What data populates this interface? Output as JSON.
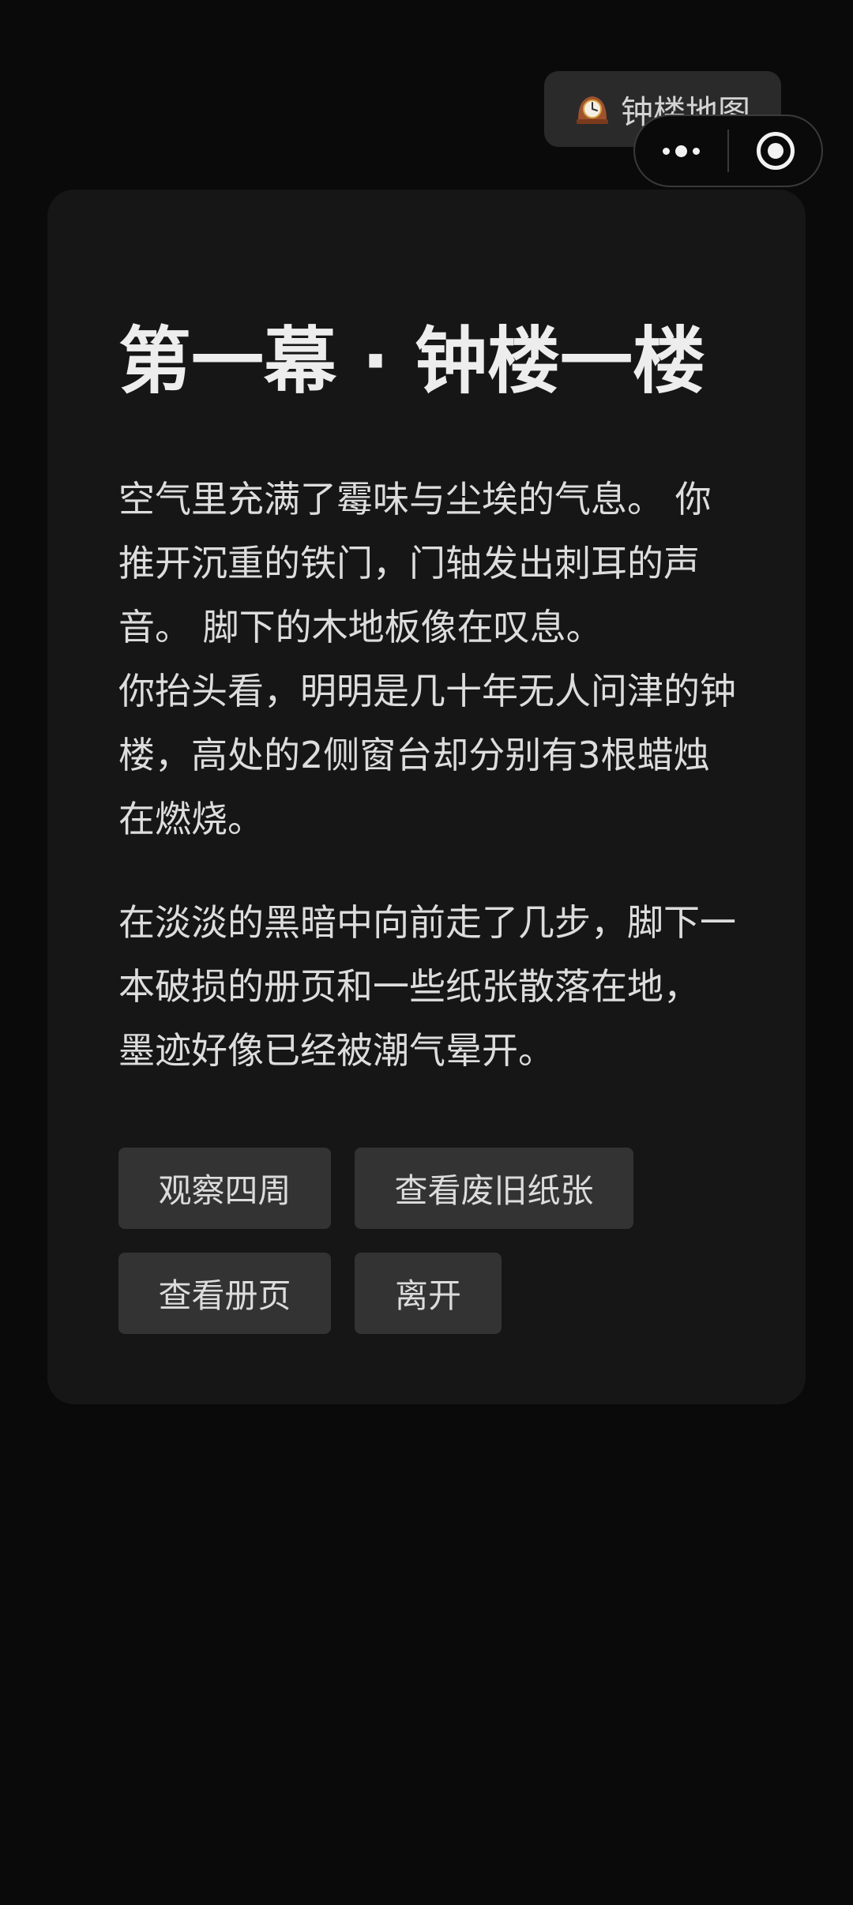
{
  "header": {
    "map_button_label": "钟楼地图",
    "map_icon": "mantelpiece-clock-icon",
    "capsule": {
      "more_icon": "more-dots-icon",
      "close_icon": "target-circle-icon"
    }
  },
  "scene": {
    "title": "第一幕 · 钟楼一楼",
    "paragraphs": [
      "空气里充满了霉味与尘埃的气息。 你推开沉重的铁门，门轴发出刺耳的声音。 脚下的木地板像在叹息。\n你抬头看，明明是几十年无人问津的钟楼，高处的2侧窗台却分别有3根蜡烛在燃烧。",
      "在淡淡的黑暗中向前走了几步，脚下一本破损的册页和一些纸张散落在地， 墨迹好像已经被潮气晕开。"
    ],
    "choices": [
      {
        "label": "观察四周"
      },
      {
        "label": "查看废旧纸张"
      },
      {
        "label": "查看册页"
      },
      {
        "label": "离开"
      }
    ]
  },
  "colors": {
    "background": "#0a0a0a",
    "card": "#161616",
    "button": "#333333",
    "text": "#dddddd"
  }
}
